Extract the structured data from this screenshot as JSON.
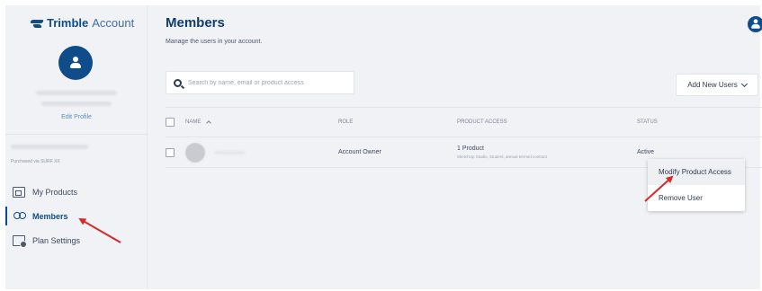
{
  "sidebar": {
    "logo": {
      "brand": "Trimble",
      "product": "Account"
    },
    "edit_profile": "Edit Profile",
    "purchased_text": "Purchased via SURF XX",
    "nav": [
      {
        "label": "My Products",
        "icon": "products-icon"
      },
      {
        "label": "Members",
        "icon": "members-icon",
        "active": true
      },
      {
        "label": "Plan Settings",
        "icon": "plan-settings-icon"
      }
    ]
  },
  "main": {
    "title": "Members",
    "subtitle": "Manage the users in your account.",
    "search": {
      "placeholder": "Search by name, email or product access"
    },
    "add_button": "Add New Users",
    "table": {
      "columns": [
        "NAME",
        "ROLE",
        "PRODUCT ACCESS",
        "STATUS"
      ],
      "rows": [
        {
          "role": "Account Owner",
          "product_access": "1 Product",
          "product_detail": "SketchUp Studio, Student, annual termed contract",
          "status": "Active"
        }
      ]
    },
    "context_menu": [
      "Modify Product Access",
      "Remove User"
    ]
  },
  "colors": {
    "accent": "#0f4c8a",
    "annotation": "#d42a2a",
    "sidebar_bg": "#f1f2f5"
  }
}
